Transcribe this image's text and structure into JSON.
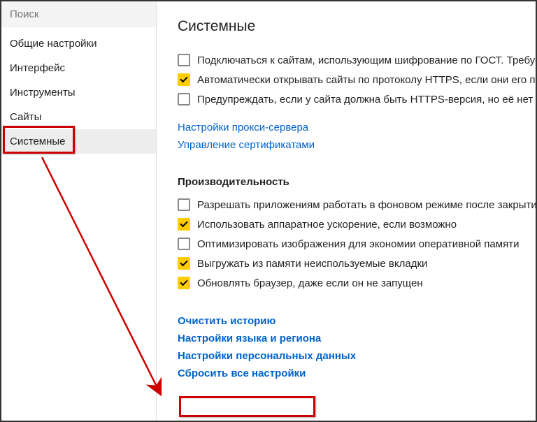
{
  "sidebar": {
    "searchPlaceholder": "Поиск",
    "items": [
      {
        "label": "Общие настройки"
      },
      {
        "label": "Интерфейс"
      },
      {
        "label": "Инструменты"
      },
      {
        "label": "Сайты"
      },
      {
        "label": "Системные"
      }
    ]
  },
  "main": {
    "title": "Системные",
    "securityOptions": [
      {
        "label": "Подключаться к сайтам, использующим шифрование по ГОСТ. Требуе",
        "checked": false
      },
      {
        "label": "Автоматически открывать сайты по протоколу HTTPS, если они его по",
        "checked": true
      },
      {
        "label": "Предупреждать, если у сайта должна быть HTTPS-версия, но её нет",
        "checked": false
      }
    ],
    "securityLinks": [
      "Настройки прокси-сервера",
      "Управление сертификатами"
    ],
    "perfTitle": "Производительность",
    "perfOptions": [
      {
        "label": "Разрешать приложениям работать в фоновом режиме после закрыти",
        "checked": false
      },
      {
        "label": "Использовать аппаратное ускорение, если возможно",
        "checked": true
      },
      {
        "label": "Оптимизировать изображения для экономии оперативной памяти",
        "checked": false
      },
      {
        "label": "Выгружать из памяти неиспользуемые вкладки",
        "checked": true
      },
      {
        "label": "Обновлять браузер, даже если он не запущен",
        "checked": true
      }
    ],
    "bottomLinks": [
      "Очистить историю",
      "Настройки языка и региона",
      "Настройки персональных данных",
      "Сбросить все настройки"
    ]
  }
}
